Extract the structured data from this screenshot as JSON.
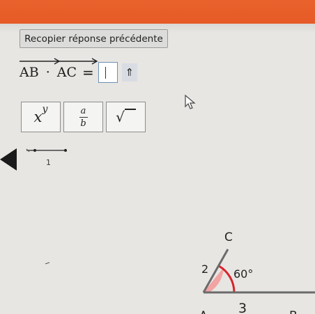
{
  "toolbar": {
    "copy_previous_label": "Recopier réponse précédente"
  },
  "equation": {
    "vector1": "AB",
    "dot_operator": "·",
    "vector2": "AC",
    "equals": "=",
    "answer_value": "",
    "shift_symbol": "⇑"
  },
  "keypad": {
    "power_base": "x",
    "power_exp": "y",
    "fraction_num": "a",
    "fraction_den": "b",
    "sqrt_symbol": "√"
  },
  "ruler": {
    "label": "1"
  },
  "figure": {
    "vertex_a": "A",
    "vertex_b": "B",
    "vertex_c": "C",
    "side_ac": "2",
    "side_ab": "3",
    "angle": "60°"
  },
  "colors": {
    "top_bar": "#e9622c",
    "angle_fill": "#f2a3a3",
    "angle_arc": "#d8232a"
  }
}
